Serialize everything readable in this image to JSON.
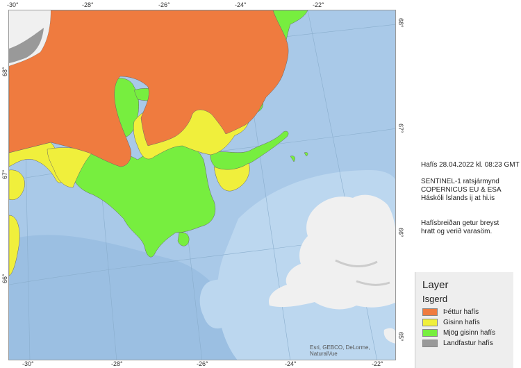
{
  "map": {
    "ticks_top": [
      "-30°",
      "-28°",
      "-26°",
      "-24°",
      "-22°"
    ],
    "ticks_bottom": [
      "-30°",
      "-28°",
      "-26°",
      "-24°",
      "-22°"
    ],
    "ticks_left": [
      "68°",
      "67°",
      "66°"
    ],
    "ticks_right": [
      "68°",
      "67°",
      "66°",
      "65°"
    ],
    "attribution": "Esri, GEBCO, DeLorme, NaturalVue",
    "colors": {
      "sea": "#a9c9e8",
      "shelf": "#bcd7ef",
      "deep": "#9bbfe2",
      "land": "#f0f0f0",
      "thick_ice": "#ef7b3f",
      "thin_ice": "#f0ef3c",
      "very_thin_ice": "#77ee3f",
      "fast_ice": "#999999"
    }
  },
  "info": {
    "line1": "Hafís 28.04.2022 kl. 08:23 GMT",
    "line2": "SENTINEL-1 ratsjármynd",
    "line3": "COPERNICUS EU  &  ESA",
    "line4": "Háskóli Íslands ij at hi.is",
    "line5": "Hafísbreiðan getur breyst",
    "line6": "hratt og verið varasöm."
  },
  "legend": {
    "title": "Layer",
    "subtitle": "Isgerd",
    "items": [
      {
        "label": "Þéttur hafís",
        "color": "#ef7b3f"
      },
      {
        "label": "Gisinn hafís",
        "color": "#f0ef3c"
      },
      {
        "label": "Mjög gisinn hafís",
        "color": "#77ee3f"
      },
      {
        "label": "Landfastur hafís",
        "color": "#999999"
      }
    ]
  }
}
